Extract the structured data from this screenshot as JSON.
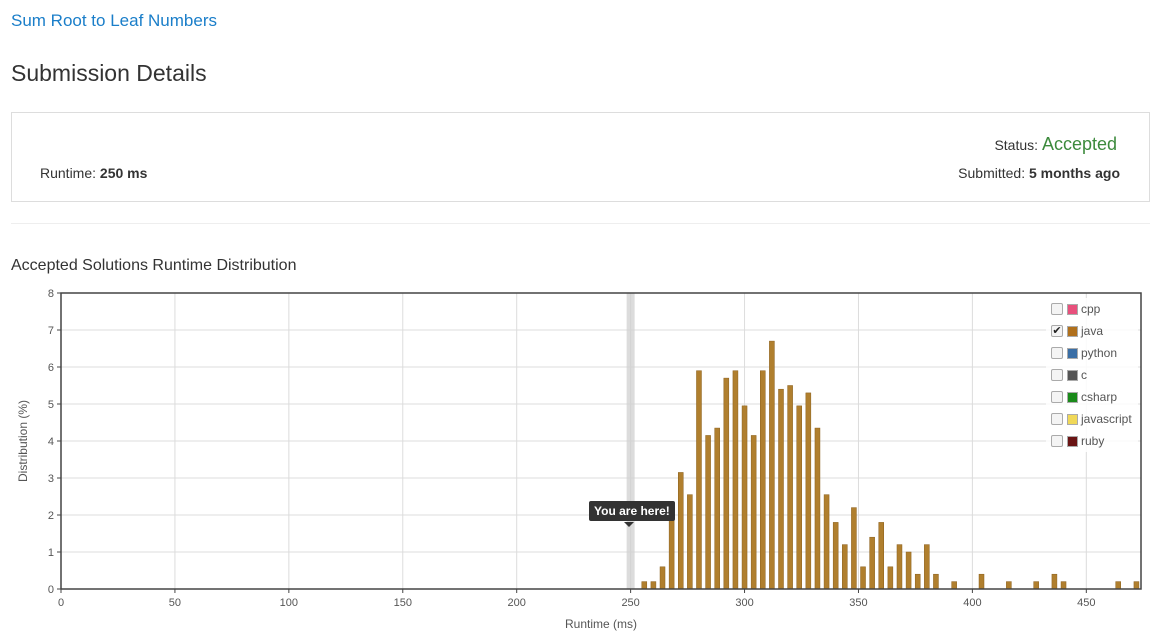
{
  "header": {
    "problem_link": "Sum Root to Leaf Numbers",
    "page_title": "Submission Details"
  },
  "details": {
    "runtime_label": "Runtime:",
    "runtime_value": "250 ms",
    "status_label": "Status:",
    "status_value": "Accepted",
    "submitted_label": "Submitted:",
    "submitted_value": "5 months ago"
  },
  "colors": {
    "link": "#1a7ec9",
    "accepted": "#3c8a3c",
    "bar": "#b07f2e",
    "bar_edge": "#8a5f1c",
    "marker": "#d0d0d0",
    "tooltip_bg": "#333333"
  },
  "legend": {
    "items": [
      {
        "label": "cpp",
        "color": "#e8507c",
        "checked": false
      },
      {
        "label": "java",
        "color": "#b0701c",
        "checked": true
      },
      {
        "label": "python",
        "color": "#3a6ea5",
        "checked": false
      },
      {
        "label": "c",
        "color": "#555555",
        "checked": false
      },
      {
        "label": "csharp",
        "color": "#1a8a1a",
        "checked": false
      },
      {
        "label": "javascript",
        "color": "#f0d858",
        "checked": false
      },
      {
        "label": "ruby",
        "color": "#6a1414",
        "checked": false
      }
    ]
  },
  "tooltip": {
    "text": "You are here!"
  },
  "chart_data": {
    "type": "bar",
    "title": "Accepted Solutions Runtime Distribution",
    "xlabel": "Runtime (ms)",
    "ylabel": "Distribution (%)",
    "xlim": [
      0,
      474
    ],
    "ylim": [
      0,
      8
    ],
    "xticks": [
      0,
      50,
      100,
      150,
      200,
      250,
      300,
      350,
      400,
      450
    ],
    "yticks": [
      0,
      1,
      2,
      3,
      4,
      5,
      6,
      7,
      8
    ],
    "grid": true,
    "legend_position": "top-right",
    "marker_x": 250,
    "series": [
      {
        "name": "java",
        "x": [
          256,
          260,
          264,
          268,
          272,
          276,
          280,
          284,
          288,
          292,
          296,
          300,
          304,
          308,
          312,
          316,
          320,
          324,
          328,
          332,
          336,
          340,
          344,
          348,
          352,
          356,
          360,
          364,
          368,
          372,
          376,
          380,
          384,
          392,
          404,
          416,
          428,
          436,
          440,
          464,
          472
        ],
        "values": [
          0.2,
          0.2,
          0.6,
          2.2,
          3.15,
          2.55,
          5.9,
          4.15,
          4.35,
          5.7,
          5.9,
          4.95,
          4.15,
          5.9,
          6.7,
          5.4,
          5.5,
          4.95,
          5.3,
          4.35,
          2.55,
          1.8,
          1.2,
          2.2,
          0.6,
          1.4,
          1.8,
          0.6,
          1.2,
          1.0,
          0.4,
          1.2,
          0.4,
          0.2,
          0.4,
          0.2,
          0.2,
          0.4,
          0.2,
          0.2,
          0.2
        ]
      }
    ]
  }
}
